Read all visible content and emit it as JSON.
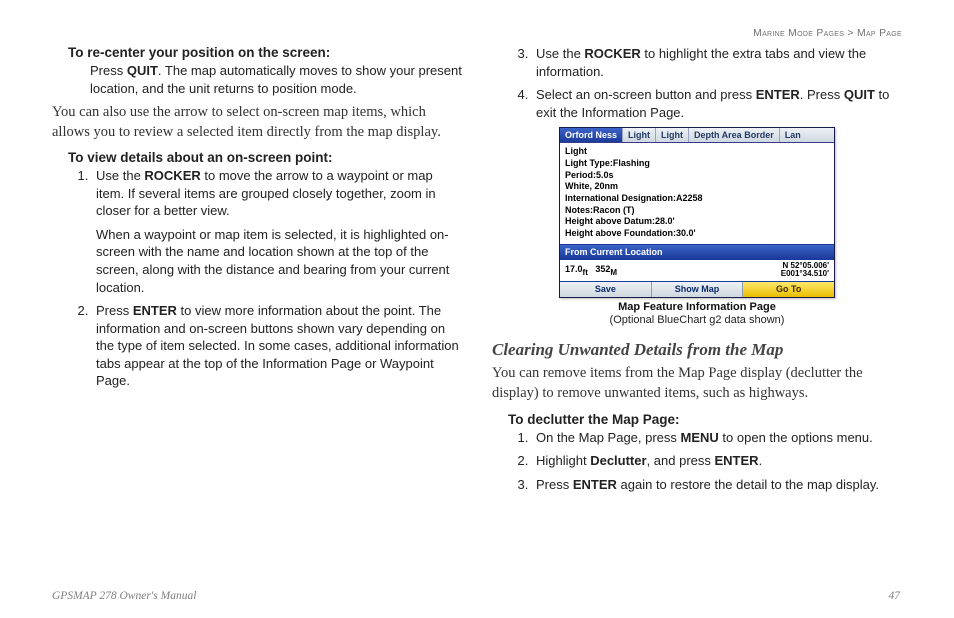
{
  "breadcrumb": {
    "section": "Marine Mode Pages",
    "sep": " > ",
    "page": "Map Page"
  },
  "left": {
    "h1": "To re-center your position on the screen:",
    "p1a": "Press ",
    "p1b": "QUIT",
    "p1c": ". The map automatically moves to show your present location, and the unit returns to position mode.",
    "serif1": "You can also use the arrow to select on-screen map items, which allows you to review a selected item directly from the map display.",
    "h2": "To view details about an on-screen point:",
    "li1a": "Use the ",
    "li1b": "ROCKER",
    "li1c": " to move the arrow to a waypoint or map item. If several items are grouped closely together, zoom in closer for a better view.",
    "li1p": "When a waypoint or map item is selected, it is highlighted on-screen with the name and location shown at the top of the screen, along with the distance and bearing from your current location.",
    "li2a": "Press ",
    "li2b": "ENTER",
    "li2c": " to view more information about the point. The information and on-screen buttons shown vary depending on the type of item selected. In some cases, additional information tabs appear at the top of the Information Page or Waypoint Page."
  },
  "right": {
    "li3a": "Use the ",
    "li3b": "ROCKER",
    "li3c": " to highlight the extra tabs and view the information.",
    "li4a": "Select an on-screen button and press ",
    "li4b": "ENTER",
    "li4c": ". Press ",
    "li4d": "QUIT",
    "li4e": " to exit the Information Page.",
    "deviceCaption1": "Map Feature Information Page",
    "deviceCaption2": "(Optional BlueChart g2 data shown)",
    "h3": "Clearing Unwanted Details from the Map",
    "serif2": "You can remove items from the Map Page display (declutter the display) to remove unwanted items, such as highways.",
    "h4": "To declutter the Map Page:",
    "d_li1a": "On the Map Page, press ",
    "d_li1b": "MENU",
    "d_li1c": " to open the options menu.",
    "d_li2a": "Highlight ",
    "d_li2b": "Declutter",
    "d_li2c": ", and press ",
    "d_li2d": "ENTER",
    "d_li2e": ".",
    "d_li3a": "Press ",
    "d_li3b": "ENTER",
    "d_li3c": " again to restore the detail to the map display."
  },
  "device": {
    "tabs": [
      "Orford Ness",
      "Light",
      "Light",
      "Depth Area Border",
      "Lan"
    ],
    "lines": [
      "Light",
      "Light Type:Flashing",
      "Period:5.0s",
      "White, 20nm",
      "International Designation:A2258",
      "Notes:Racon (T)",
      "Height above Datum:28.0'",
      "Height above Foundation:30.0'"
    ],
    "fromLabel": "From Current Location",
    "dist": "17.0",
    "distUnit": "ft",
    "bearing": "352",
    "bearingUnit": "M",
    "lat": "N  52°05.006'",
    "lon": "E001°34.510'",
    "buttons": [
      "Save",
      "Show Map",
      "Go To"
    ]
  },
  "footer": {
    "manual": "GPSMAP 278 Owner's Manual",
    "page": "47"
  }
}
